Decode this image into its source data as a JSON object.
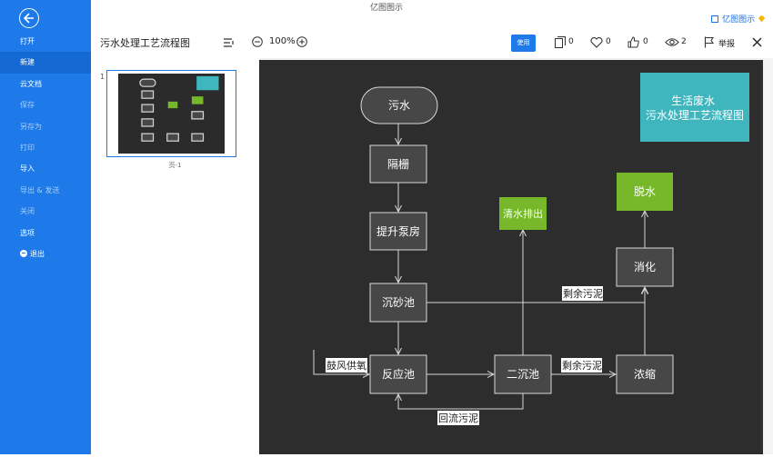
{
  "app": {
    "title": "亿图图示",
    "brand": "亿图图示"
  },
  "sidebar": {
    "items": [
      {
        "label": "打开"
      },
      {
        "label": "新建"
      },
      {
        "label": "云文档"
      },
      {
        "label": "保存"
      },
      {
        "label": "另存为"
      },
      {
        "label": "打印"
      },
      {
        "label": "导入"
      },
      {
        "label": "导出 & 发送"
      },
      {
        "label": "关闭"
      },
      {
        "label": "选项"
      },
      {
        "label": "退出"
      }
    ]
  },
  "toolbar": {
    "doc_title": "污水处理工艺流程图",
    "zoom": "100%",
    "use_label": "使用",
    "copies": "0",
    "likes": "0",
    "thumbs_up": "0",
    "views": "2",
    "report_label": "举报"
  },
  "thumbnails": {
    "page_number": "1",
    "page_label": "页-1"
  },
  "diagram": {
    "title": "生活废水\n污水处理工艺流程图",
    "nodes": {
      "sewage": "污水",
      "grille": "隔栅",
      "pump": "提升泵房",
      "grit": "沉砂池",
      "reactor": "反应池",
      "secondary": "二沉池",
      "thicken": "浓缩",
      "digest": "消化",
      "dewater": "脱水",
      "clearwater": "清水排出"
    },
    "labels": {
      "excess_sludge_1": "剩余污泥",
      "excess_sludge_2": "剩余污泥",
      "aeration": "鼓风供氧",
      "return_sludge": "回流污泥"
    },
    "colors": {
      "bg": "#2d2d2d",
      "box": "#474747",
      "green": "#76b82a",
      "teal": "#3fb6bd",
      "line": "#d8d8d8"
    }
  }
}
